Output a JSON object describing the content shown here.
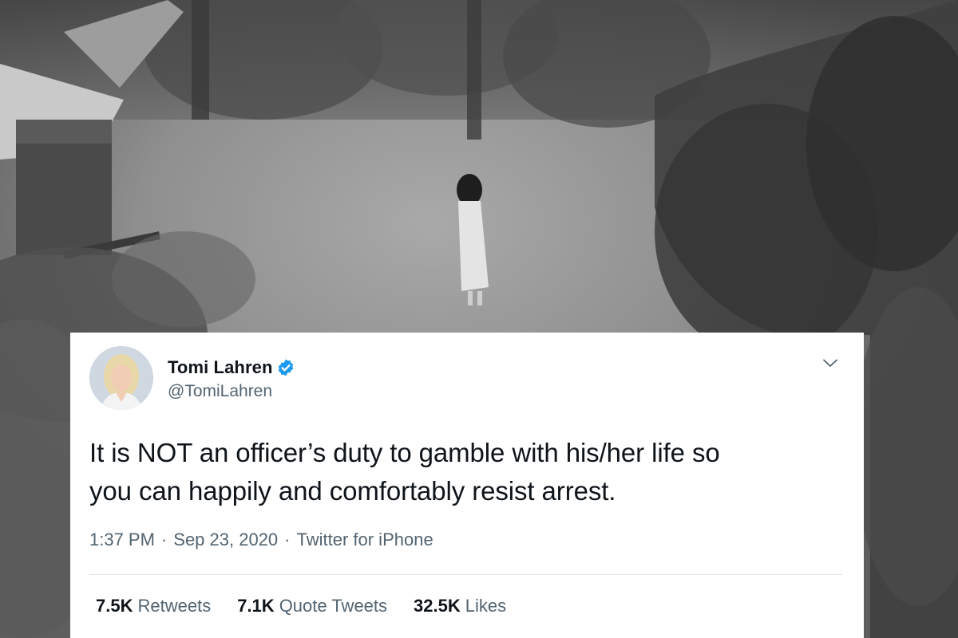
{
  "tweet": {
    "display_name": "Tomi Lahren",
    "handle": "@TomiLahren",
    "verified": true,
    "text_line1": "It is NOT an officer’s duty to gamble with his/her life so",
    "text_line2": "you can happily and comfortably resist arrest.",
    "time": "1:37 PM",
    "date": "Sep 23, 2020",
    "source": "Twitter for iPhone",
    "separator": "·",
    "stats": {
      "retweets_count": "7.5K",
      "retweets_label": "Retweets",
      "quotes_count": "7.1K",
      "quotes_label": "Quote Tweets",
      "likes_count": "32.5K",
      "likes_label": "Likes"
    }
  },
  "icons": {
    "verified": "verified-badge-icon",
    "menu": "chevron-down-icon"
  },
  "colors": {
    "verified_blue": "#1d9bf0",
    "text_primary": "#0f1419",
    "text_secondary": "#536471",
    "card_bg": "#ffffff",
    "divider": "#dde3e8"
  }
}
